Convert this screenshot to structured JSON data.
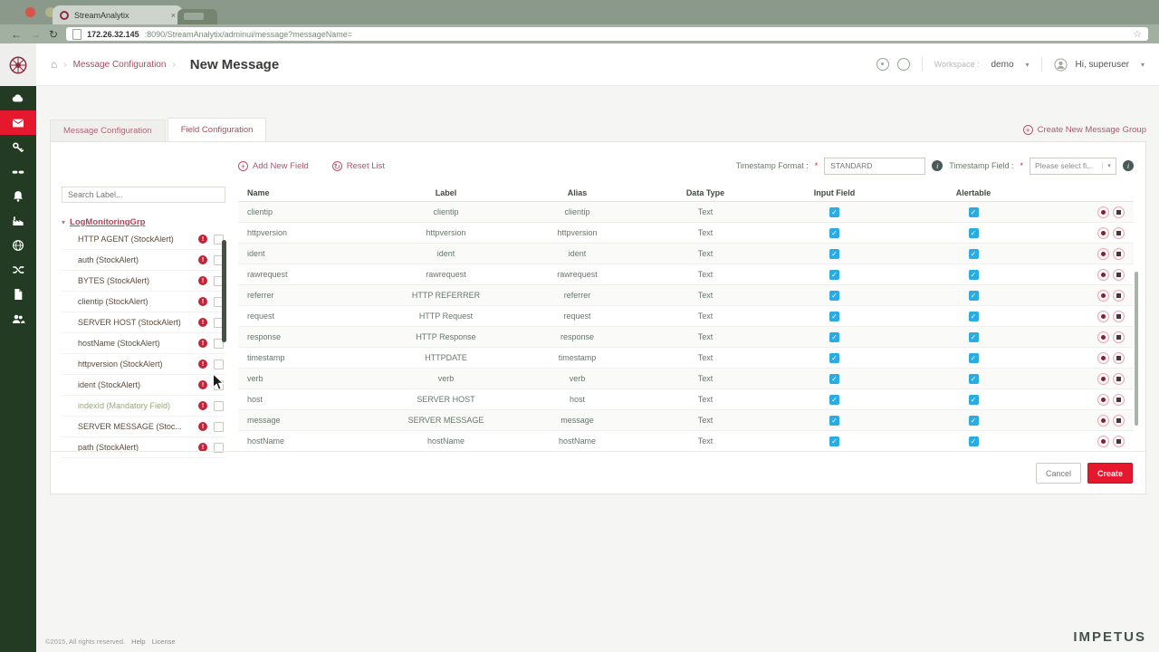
{
  "colors": {
    "accent_red": "#e5182d",
    "brand_maroon": "#8e2a3e",
    "link_red": "#b5556a",
    "checkbox_blue": "#2aabe2",
    "sidebar_green": "#223b22",
    "text_gray_green": "#5f6f5f"
  },
  "browser": {
    "tab_title": "StreamAnalytix",
    "close_glyph": "×",
    "url_host": "172.26.32.145",
    "url_rest": ":8090/StreamAnalytix/adminui/message?messageName="
  },
  "header": {
    "breadcrumb_parent": "Message Configuration",
    "page_title": "New Message",
    "workspace_label": "Workspace :",
    "workspace_value": "demo",
    "user_greeting": "Hi, superuser"
  },
  "sidebar": {
    "icons": [
      {
        "name": "cloud-icon",
        "active": false
      },
      {
        "name": "message-icon",
        "active": true
      },
      {
        "name": "key-icon",
        "active": false
      },
      {
        "name": "link-icon",
        "active": false
      },
      {
        "name": "bell-icon",
        "active": false
      },
      {
        "name": "industry-icon",
        "active": false
      },
      {
        "name": "globe-icon",
        "active": false
      },
      {
        "name": "shuffle-icon",
        "active": false
      },
      {
        "name": "document-icon",
        "active": false
      },
      {
        "name": "users-icon",
        "active": false
      }
    ]
  },
  "tabs": {
    "message_configuration": "Message Configuration",
    "field_configuration": "Field Configuration",
    "create_group": "Create New Message Group"
  },
  "left_panel": {
    "search_placeholder": "Search Label...",
    "group_name": "LogMonitoringGrp",
    "items": [
      {
        "label": "HTTP AGENT (StockAlert)",
        "muted": false
      },
      {
        "label": "auth (StockAlert)",
        "muted": false
      },
      {
        "label": "BYTES (StockAlert)",
        "muted": false
      },
      {
        "label": "clientip (StockAlert)",
        "muted": false
      },
      {
        "label": "SERVER HOST (StockAlert)",
        "muted": false
      },
      {
        "label": "hostName (StockAlert)",
        "muted": false
      },
      {
        "label": "httpversion (StockAlert)",
        "muted": false
      },
      {
        "label": "ident (StockAlert)",
        "muted": false
      },
      {
        "label": "indexId (Mandatory Field)",
        "muted": true
      },
      {
        "label": "SERVER MESSAGE (Stoc...",
        "muted": false
      },
      {
        "label": "path (StockAlert)",
        "muted": false
      }
    ]
  },
  "toolbar": {
    "add_new_field": "Add New Field",
    "reset_list": "Reset List",
    "timestamp_format_label": "Timestamp Format :",
    "required_marker": "*",
    "timestamp_format_value": "STANDARD",
    "timestamp_field_label": "Timestamp Field :",
    "timestamp_field_placeholder": "Please select fi..."
  },
  "table": {
    "columns": [
      "Name",
      "Label",
      "Alias",
      "Data Type",
      "Input Field",
      "Alertable"
    ],
    "rows": [
      {
        "name": "clientip",
        "label": "clientip",
        "alias": "clientip",
        "data_type": "Text",
        "input_field": true,
        "alertable": true
      },
      {
        "name": "httpversion",
        "label": "httpversion",
        "alias": "httpversion",
        "data_type": "Text",
        "input_field": true,
        "alertable": true
      },
      {
        "name": "ident",
        "label": "ident",
        "alias": "ident",
        "data_type": "Text",
        "input_field": true,
        "alertable": true
      },
      {
        "name": "rawrequest",
        "label": "rawrequest",
        "alias": "rawrequest",
        "data_type": "Text",
        "input_field": true,
        "alertable": true
      },
      {
        "name": "referrer",
        "label": "HTTP REFERRER",
        "alias": "referrer",
        "data_type": "Text",
        "input_field": true,
        "alertable": true
      },
      {
        "name": "request",
        "label": "HTTP Request",
        "alias": "request",
        "data_type": "Text",
        "input_field": true,
        "alertable": true
      },
      {
        "name": "response",
        "label": "HTTP Response",
        "alias": "response",
        "data_type": "Text",
        "input_field": true,
        "alertable": true
      },
      {
        "name": "timestamp",
        "label": "HTTPDATE",
        "alias": "timestamp",
        "data_type": "Text",
        "input_field": true,
        "alertable": true
      },
      {
        "name": "verb",
        "label": "verb",
        "alias": "verb",
        "data_type": "Text",
        "input_field": true,
        "alertable": true
      },
      {
        "name": "host",
        "label": "SERVER HOST",
        "alias": "host",
        "data_type": "Text",
        "input_field": true,
        "alertable": true
      },
      {
        "name": "message",
        "label": "SERVER MESSAGE",
        "alias": "message",
        "data_type": "Text",
        "input_field": true,
        "alertable": true
      },
      {
        "name": "hostName",
        "label": "hostName",
        "alias": "hostName",
        "data_type": "Text",
        "input_field": true,
        "alertable": true
      }
    ]
  },
  "footer_actions": {
    "cancel": "Cancel",
    "create": "Create"
  },
  "page_footer": {
    "copyright": "©2015, All rights reserved.",
    "help": "Help",
    "license": "License",
    "brand": "IMPETUS"
  }
}
